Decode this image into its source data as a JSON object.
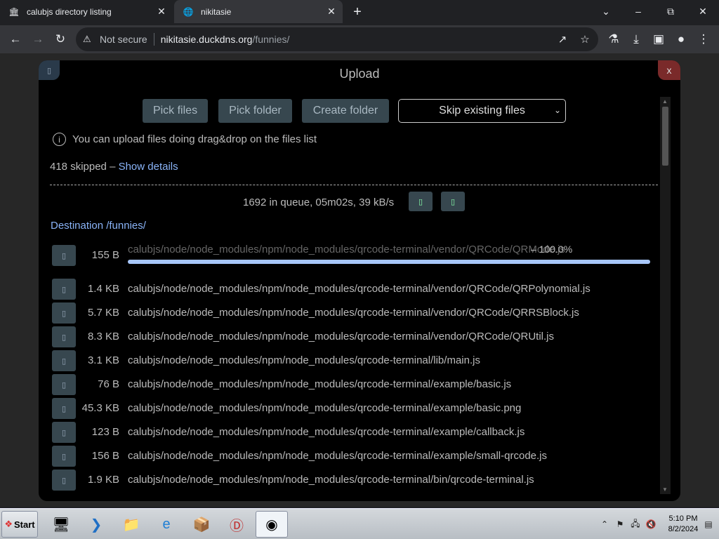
{
  "tabs": [
    {
      "title": "calubjs directory listing",
      "icon": "bank-icon"
    },
    {
      "title": "nikitasie",
      "icon": "globe-icon"
    }
  ],
  "address": {
    "security_label": "Not secure",
    "host": "nikitasie.duckdns.org",
    "path": "/funnies/"
  },
  "modal": {
    "title": "Upload",
    "close_label": "x",
    "buttons": {
      "pick_files": "Pick files",
      "pick_folder": "Pick folder",
      "create_folder": "Create folder"
    },
    "select_value": "Skip existing files",
    "info_text": "You can upload files doing drag&drop on the files list",
    "skipped_text": "418 skipped – ",
    "show_details": "Show details",
    "queue_text": "1692 in queue, 05m02s, 39 kB/s",
    "destination": "Destination /funnies/",
    "files": [
      {
        "size": "155 B",
        "path": "calubjs/node/node_modules/npm/node_modules/qrcode-terminal/vendor/QRCode/QRMode.js",
        "progress_label": "– 100.0%",
        "progress": 1.0
      },
      {
        "size": "1.4 KB",
        "path": "calubjs/node/node_modules/npm/node_modules/qrcode-terminal/vendor/QRCode/QRPolynomial.js"
      },
      {
        "size": "5.7 KB",
        "path": "calubjs/node/node_modules/npm/node_modules/qrcode-terminal/vendor/QRCode/QRRSBlock.js"
      },
      {
        "size": "8.3 KB",
        "path": "calubjs/node/node_modules/npm/node_modules/qrcode-terminal/vendor/QRCode/QRUtil.js"
      },
      {
        "size": "3.1 KB",
        "path": "calubjs/node/node_modules/npm/node_modules/qrcode-terminal/lib/main.js"
      },
      {
        "size": "76 B",
        "path": "calubjs/node/node_modules/npm/node_modules/qrcode-terminal/example/basic.js"
      },
      {
        "size": "45.3 KB",
        "path": "calubjs/node/node_modules/npm/node_modules/qrcode-terminal/example/basic.png"
      },
      {
        "size": "123 B",
        "path": "calubjs/node/node_modules/npm/node_modules/qrcode-terminal/example/callback.js"
      },
      {
        "size": "156 B",
        "path": "calubjs/node/node_modules/npm/node_modules/qrcode-terminal/example/small-qrcode.js"
      },
      {
        "size": "1.9 KB",
        "path": "calubjs/node/node_modules/npm/node_modules/qrcode-terminal/bin/qrcode-terminal.js"
      }
    ]
  },
  "taskbar": {
    "start_label": "Start",
    "apps": [
      "server-manager-icon",
      "powershell-icon",
      "explorer-folder-icon",
      "internet-explorer-icon",
      "archive-icon",
      "app-d-icon",
      "chrome-icon"
    ],
    "time": "5:10 PM",
    "date": "8/2/2024"
  },
  "colors": {
    "link": "#8ab4f8",
    "progress": "#a8c7fa",
    "button_bg": "#37474f"
  }
}
